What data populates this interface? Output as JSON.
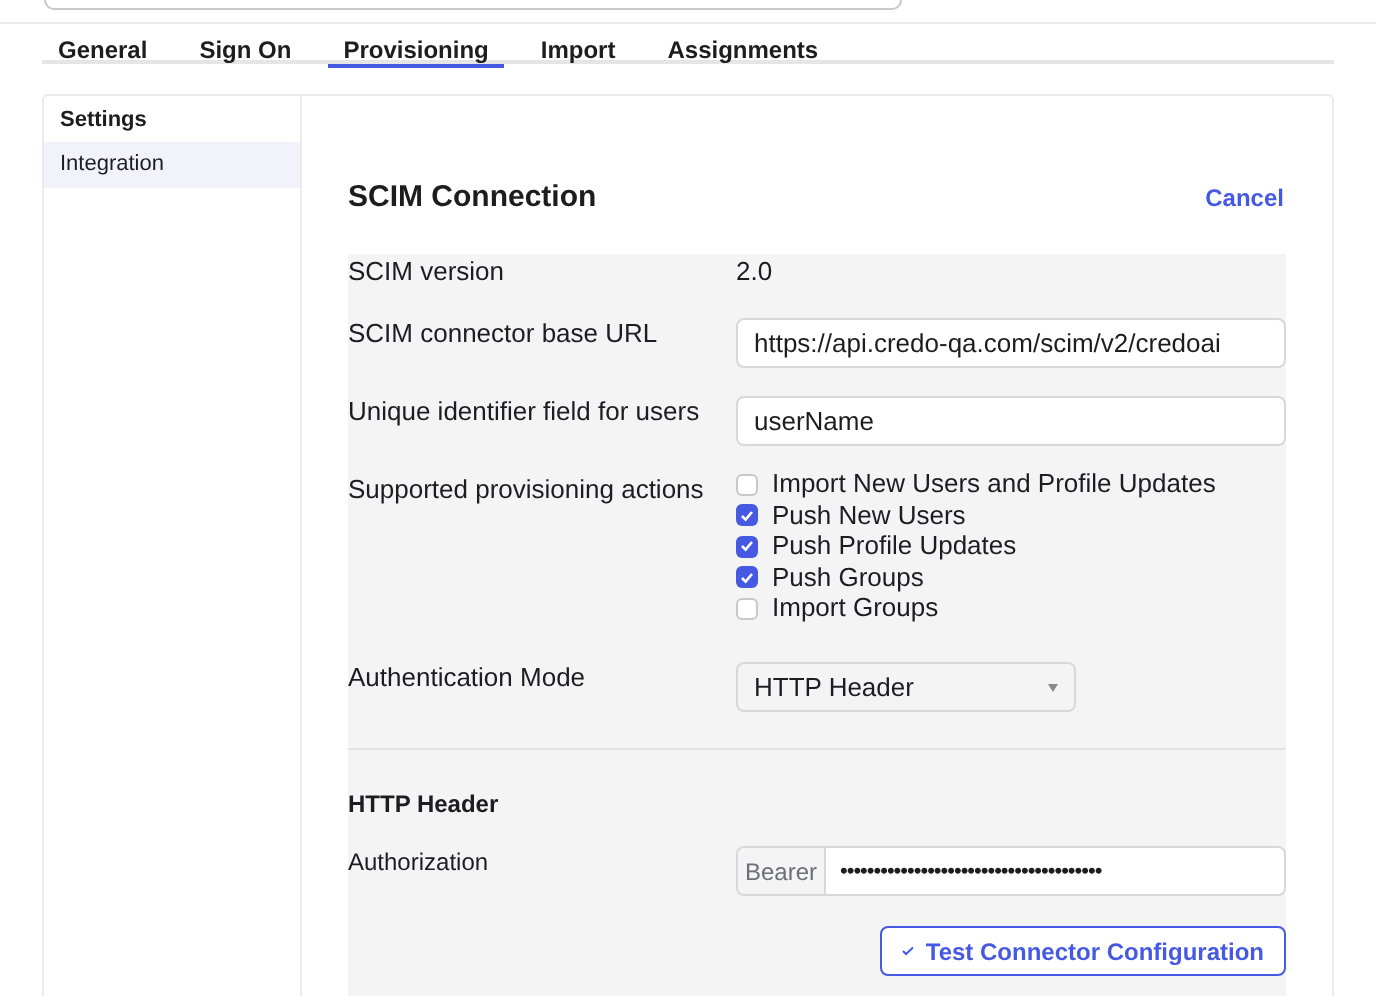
{
  "tabs": [
    {
      "label": "General",
      "selected": false
    },
    {
      "label": "Sign On",
      "selected": false
    },
    {
      "label": "Provisioning",
      "selected": true
    },
    {
      "label": "Import",
      "selected": false
    },
    {
      "label": "Assignments",
      "selected": false
    }
  ],
  "sidebar": {
    "heading": "Settings",
    "items": [
      {
        "label": "Integration",
        "selected": true
      }
    ]
  },
  "section": {
    "title": "SCIM Connection",
    "cancel": "Cancel"
  },
  "fields": [
    {
      "kind": "text",
      "label": "SCIM version",
      "value": "2.0"
    },
    {
      "kind": "input",
      "label": "SCIM connector base URL",
      "value": "https://api.credo-qa.com/scim/v2/credoai"
    },
    {
      "kind": "input",
      "label": "Unique identifier field for users",
      "value": "userName"
    },
    {
      "kind": "checkboxes",
      "label": "Supported provisioning actions",
      "options": [
        {
          "label": "Import New Users and Profile Updates",
          "checked": false
        },
        {
          "label": "Push New Users",
          "checked": true
        },
        {
          "label": "Push Profile Updates",
          "checked": true
        },
        {
          "label": "Push Groups",
          "checked": true
        },
        {
          "label": "Import Groups",
          "checked": false
        }
      ]
    },
    {
      "kind": "select",
      "label": "Authentication Mode",
      "value": "HTTP Header"
    }
  ],
  "header_section": {
    "title": "HTTP Header",
    "label": "Authorization",
    "prefix": "Bearer",
    "value": "•••••••••••••••••••••••••••••••••••••••"
  },
  "test_button": "Test Connector Configuration"
}
